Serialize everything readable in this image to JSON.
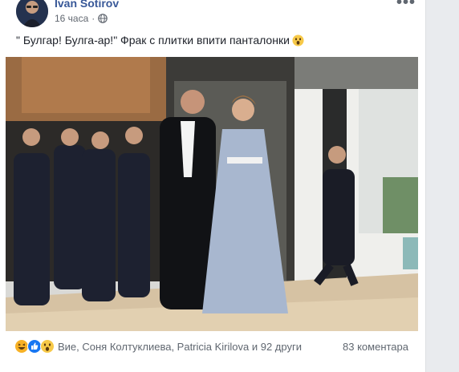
{
  "post": {
    "author": "Ivan Sotirov",
    "time": "16 часа",
    "more_label": "•••",
    "text": "\" Булгар! Булга-ар!\" Фрак с плитки впити панталонки"
  },
  "footer": {
    "reaction_names": "Вие, Соня Колтуклиева, Patricia Kirilova и 92 други",
    "comments": "83 коментара"
  },
  "colors": {
    "author_link": "#385898",
    "meta_text": "#616770",
    "like_blue": "#1877f2",
    "haha_yellow": "#f7b125"
  },
  "icons": [
    "globe-icon",
    "wow-emoji-icon",
    "haha-reaction-icon",
    "like-reaction-icon",
    "wow-reaction-icon"
  ]
}
